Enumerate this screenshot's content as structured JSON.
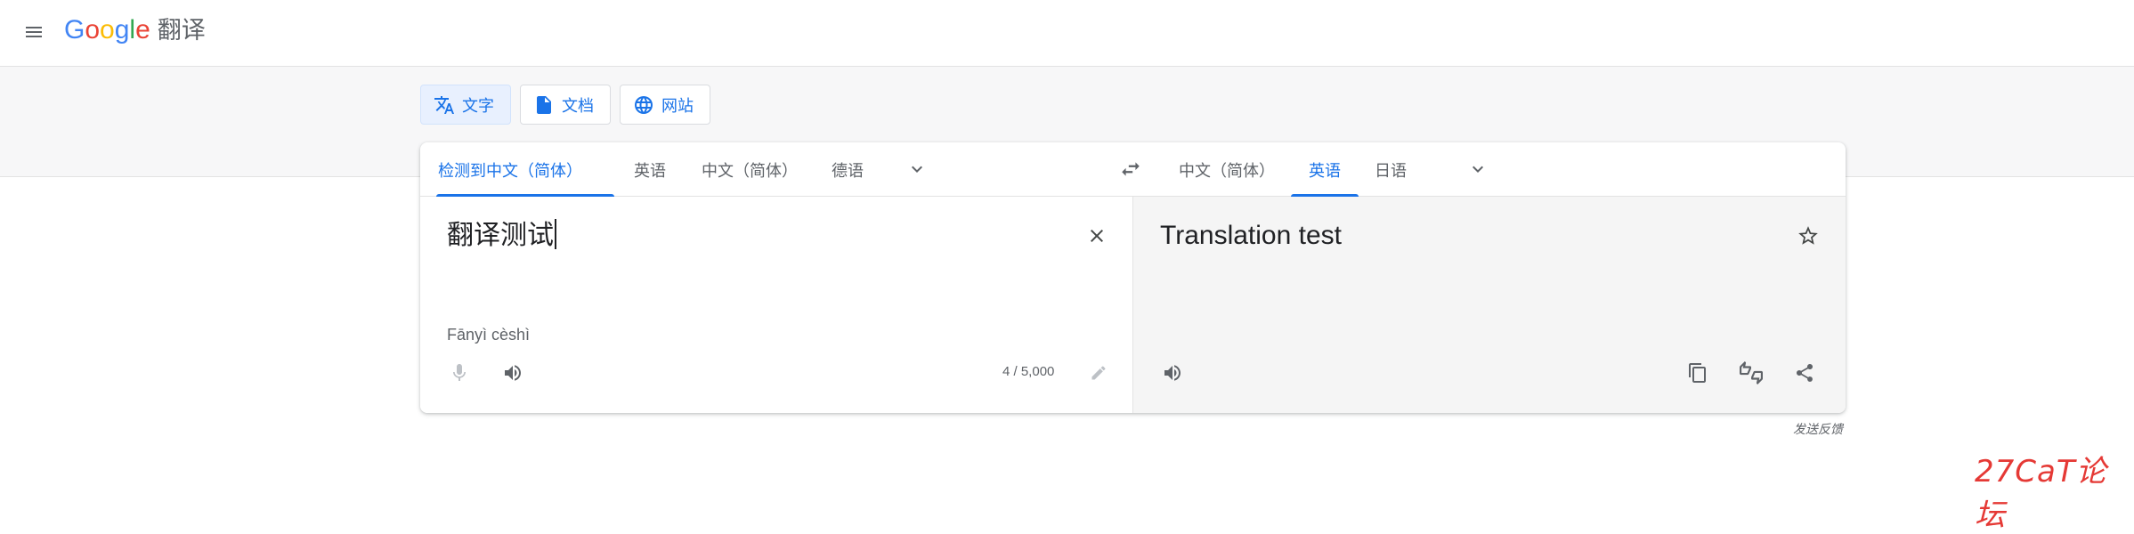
{
  "header": {
    "logo_letters": [
      {
        "ch": "G",
        "color": "#4285F4"
      },
      {
        "ch": "o",
        "color": "#EA4335"
      },
      {
        "ch": "o",
        "color": "#FBBC05"
      },
      {
        "ch": "g",
        "color": "#4285F4"
      },
      {
        "ch": "l",
        "color": "#34A853"
      },
      {
        "ch": "e",
        "color": "#EA4335"
      }
    ],
    "product_name": "翻译",
    "menu_icon": "hamburger-menu-icon"
  },
  "modes": [
    {
      "label": "文字",
      "icon": "translate-icon",
      "active": true
    },
    {
      "label": "文档",
      "icon": "document-icon",
      "active": false
    },
    {
      "label": "网站",
      "icon": "globe-icon",
      "active": false
    }
  ],
  "source_langs": {
    "detected": "检测到中文（简体）",
    "lang1": "英语",
    "lang2": "中文（简体）",
    "lang3": "德语"
  },
  "target_langs": {
    "lang1": "中文（简体）",
    "lang2": "英语",
    "lang3": "日语"
  },
  "source": {
    "text": "翻译测试",
    "romanization": "Fānyì cèshì",
    "char_count": "4 / 5,000"
  },
  "target": {
    "text": "Translation test"
  },
  "feedback_label": "发送反馈",
  "watermark": "27CaT论坛",
  "colors": {
    "accent": "#1a73e8",
    "active_mode_bg": "#e8f0fe",
    "band_bg": "#f7f7f8",
    "target_bg": "#f5f5f5",
    "icon_grey": "#5f6368",
    "watermark_red": "#e53935"
  }
}
